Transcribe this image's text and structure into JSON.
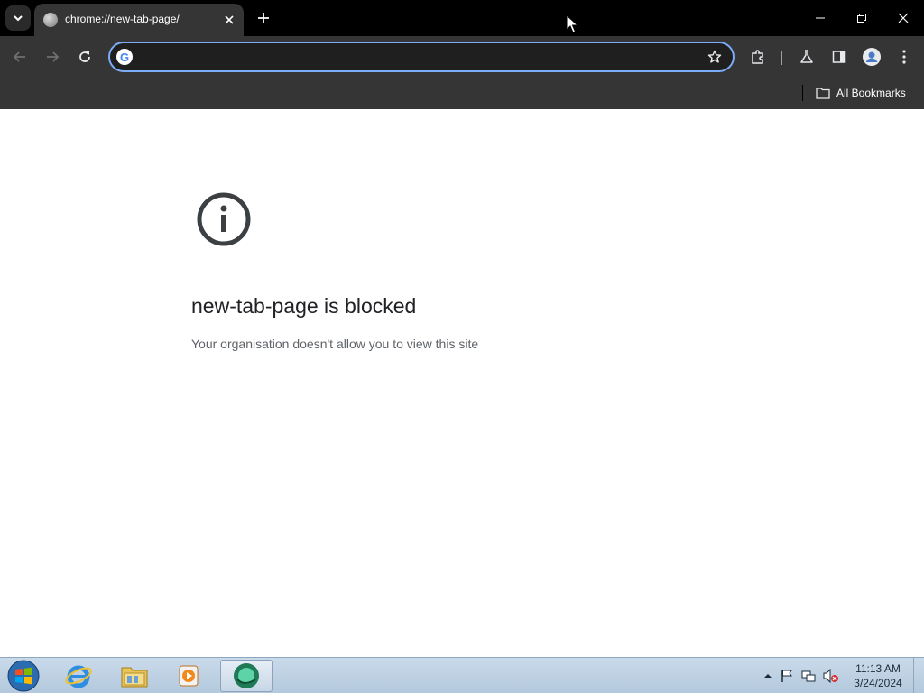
{
  "browser": {
    "tab_title": "chrome://new-tab-page/",
    "omnibox_value": "",
    "bookmarks_label": "All Bookmarks"
  },
  "page": {
    "title": "new-tab-page is blocked",
    "subtitle": "Your organisation doesn't allow you to view this site"
  },
  "taskbar": {
    "time": "11:13 AM",
    "date": "3/24/2024"
  },
  "colors": {
    "omnibox_focus": "#7cacf8",
    "toolbar_bg": "#353535",
    "tabstrip_bg": "#000000"
  }
}
